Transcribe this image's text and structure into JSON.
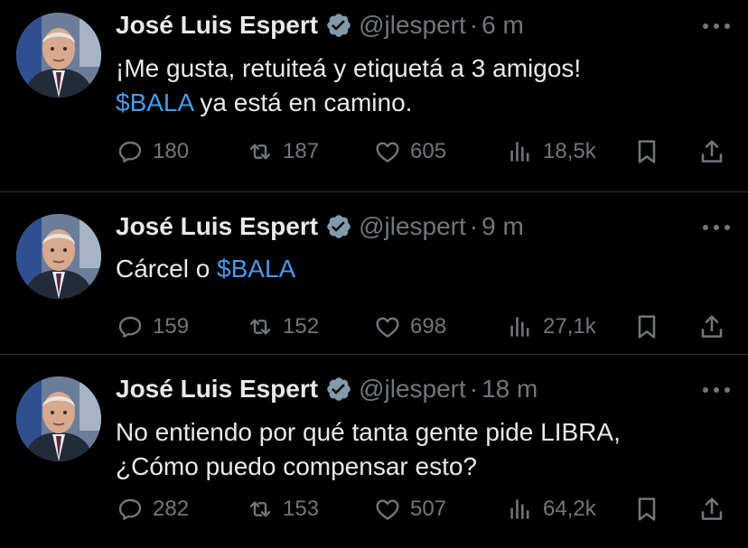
{
  "colors": {
    "background": "#000000",
    "text": "#e7e9ea",
    "muted": "#71767b",
    "link": "#4a99e9",
    "divider": "#2f3336",
    "verified": "#829aab"
  },
  "icons": {
    "reply": "speech-bubble",
    "retweet": "retweet-arrows",
    "like": "heart",
    "views": "bar-chart",
    "bookmark": "bookmark",
    "share": "share-up-arrow",
    "verified": "verified-badge",
    "more": "three-dots"
  },
  "tweets": [
    {
      "author": {
        "name": "José Luis Espert",
        "handle": "@jlespert"
      },
      "separator": "·",
      "time": "6 m",
      "text": {
        "line1": "¡Me gusta, retuiteá y etiquetá a 3 amigos!",
        "line2_link": "$BALA",
        "line2_rest": " ya está en camino."
      },
      "stats": {
        "replies": "180",
        "retweets": "187",
        "likes": "605",
        "views": "18,5k"
      }
    },
    {
      "author": {
        "name": "José Luis Espert",
        "handle": "@jlespert"
      },
      "separator": "·",
      "time": "9 m",
      "text": {
        "pre": "Cárcel o ",
        "link": "$BALA"
      },
      "stats": {
        "replies": "159",
        "retweets": "152",
        "likes": "698",
        "views": "27,1k"
      }
    },
    {
      "author": {
        "name": "José Luis Espert",
        "handle": "@jlespert"
      },
      "separator": "·",
      "time": "18 m",
      "text": {
        "line1": "No entiendo por qué tanta gente pide LIBRA,",
        "line2": "¿Cómo puedo compensar esto?"
      },
      "stats": {
        "replies": "282",
        "retweets": "153",
        "likes": "507",
        "views": "64,2k"
      }
    }
  ]
}
